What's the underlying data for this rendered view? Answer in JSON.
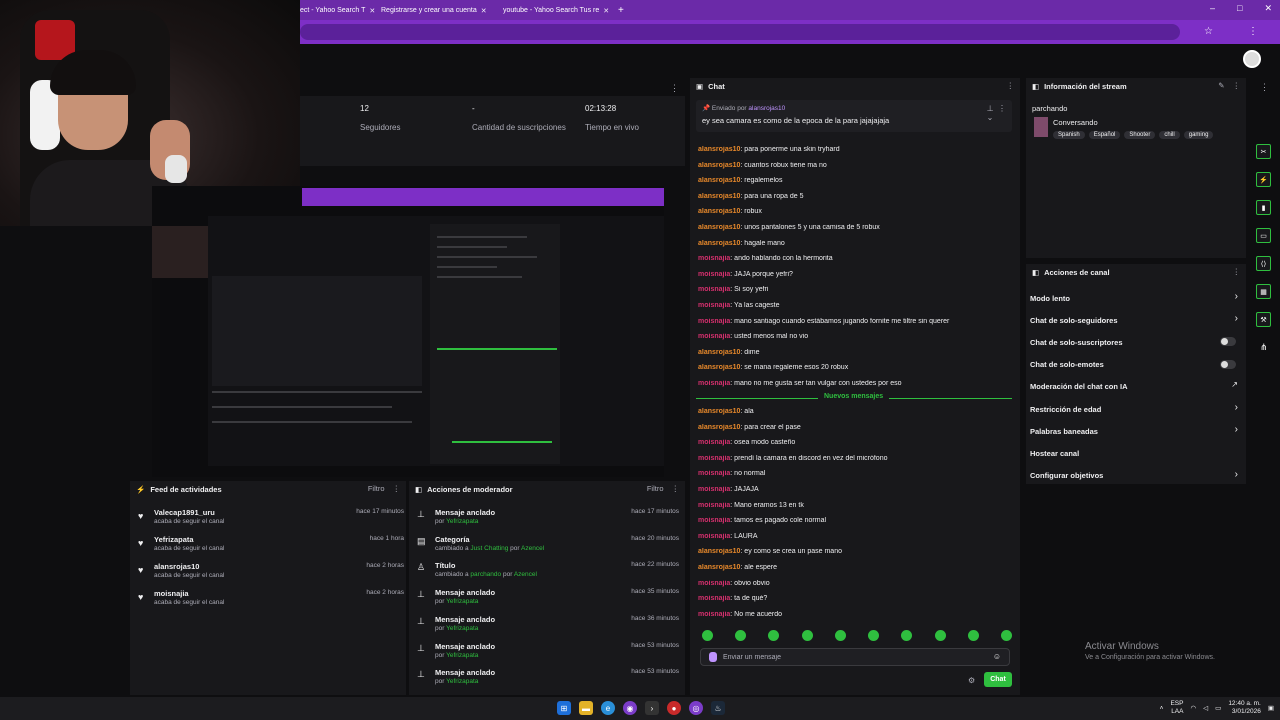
{
  "browser": {
    "tabs": [
      {
        "label": "ect - Yahoo Search T"
      },
      {
        "label": "Registrarse y crear una cuenta"
      },
      {
        "label": "youtube - Yahoo Search Tus re"
      }
    ],
    "new_tab": "+"
  },
  "stats": [
    {
      "value": "12",
      "label": "Seguidores"
    },
    {
      "value": "-",
      "label": "Cantidad de suscripciones"
    },
    {
      "value": "02:13:28",
      "label": "Tiempo en vivo"
    }
  ],
  "activity_feed": {
    "title": "Feed de actividades",
    "filter": "Filtro",
    "items": [
      {
        "user": "Valecap1891_uru",
        "action": "acaba de seguir el canal",
        "time": "hace 17 minutos"
      },
      {
        "user": "Yefrizapata",
        "action": "acaba de seguir el canal",
        "time": "hace 1 hora"
      },
      {
        "user": "alansrojas10",
        "action": "acaba de seguir el canal",
        "time": "hace 2 horas"
      },
      {
        "user": "moisnajia",
        "action": "acaba de seguir el canal",
        "time": "hace 2 horas"
      }
    ]
  },
  "mod_actions": {
    "title": "Acciones de moderador",
    "filter": "Filtro",
    "items": [
      {
        "icon": "pin-icon",
        "title": "Mensaje anclado",
        "pre": "por",
        "hl1": "Yefrizapata",
        "mid": "",
        "hl2": "",
        "time": "hace 17 minutos"
      },
      {
        "icon": "category-icon",
        "title": "Categoría",
        "pre": "cambiado a",
        "hl1": "Just Chatting",
        "mid": "por",
        "hl2": "Azencel",
        "time": "hace 20 minutos"
      },
      {
        "icon": "title-icon",
        "title": "Título",
        "pre": "cambiado a",
        "hl1": "parchando",
        "mid": "por",
        "hl2": "Azencel",
        "time": "hace 22 minutos"
      },
      {
        "icon": "pin-icon",
        "title": "Mensaje anclado",
        "pre": "por",
        "hl1": "Yefrizapata",
        "mid": "",
        "hl2": "",
        "time": "hace 35 minutos"
      },
      {
        "icon": "pin-icon",
        "title": "Mensaje anclado",
        "pre": "por",
        "hl1": "Yefrizapata",
        "mid": "",
        "hl2": "",
        "time": "hace 36 minutos"
      },
      {
        "icon": "pin-icon",
        "title": "Mensaje anclado",
        "pre": "por",
        "hl1": "Yefrizapata",
        "mid": "",
        "hl2": "",
        "time": "hace 53 minutos"
      },
      {
        "icon": "pin-icon",
        "title": "Mensaje anclado",
        "pre": "por",
        "hl1": "Yefrizapata",
        "mid": "",
        "hl2": "",
        "time": "hace 53 minutos"
      }
    ]
  },
  "chat": {
    "title": "Chat",
    "pinned": {
      "label": "Enviado por",
      "user": "alansrojas10",
      "message": "ey sea camara es como de la epoca de la para jajajajaja"
    },
    "messages": [
      {
        "user": "alansrojas10",
        "color": "#e8892b",
        "text": ": para ponerme una skin tryhard"
      },
      {
        "user": "alansrojas10",
        "color": "#e8892b",
        "text": ": cuantos robux tiene ma no"
      },
      {
        "user": "alansrojas10",
        "color": "#e8892b",
        "text": ": regalemelos"
      },
      {
        "user": "alansrojas10",
        "color": "#e8892b",
        "text": ": para una ropa de 5"
      },
      {
        "user": "alansrojas10",
        "color": "#e8892b",
        "text": ": robux"
      },
      {
        "user": "alansrojas10",
        "color": "#e8892b",
        "text": ": unos pantalones 5 y una camisa de 5 robux"
      },
      {
        "user": "alansrojas10",
        "color": "#e8892b",
        "text": ": hagale mano"
      },
      {
        "user": "moisnajia",
        "color": "#d6306e",
        "text": ": ando hablando con la hermorita"
      },
      {
        "user": "moisnajia",
        "color": "#d6306e",
        "text": ": JAJA porque yefri?"
      },
      {
        "user": "moisnajia",
        "color": "#d6306e",
        "text": ": Si soy yefri"
      },
      {
        "user": "moisnajia",
        "color": "#d6306e",
        "text": ": Ya las cageste"
      },
      {
        "user": "moisnajia",
        "color": "#d6306e",
        "text": ": mano santiago cuando estábamos jugando fornite me tiltre sin querer"
      },
      {
        "user": "moisnajia",
        "color": "#d6306e",
        "text": ": usted menos mal no vio"
      },
      {
        "user": "alansrojas10",
        "color": "#e8892b",
        "text": ": dime"
      },
      {
        "user": "alansrojas10",
        "color": "#e8892b",
        "text": ": se mana regaleme esos 20 robux"
      },
      {
        "user": "moisnajia",
        "color": "#d6306e",
        "text": ": mano no me gusta ser tan vulgar con ustedes por eso"
      }
    ],
    "new_messages_label": "Nuevos mensajes",
    "new_messages": [
      {
        "user": "alansrojas10",
        "color": "#e8892b",
        "text": ": ala"
      },
      {
        "user": "alansrojas10",
        "color": "#e8892b",
        "text": ": para crear el pase"
      },
      {
        "user": "moisnajia",
        "color": "#d6306e",
        "text": ": osea modo casteño"
      },
      {
        "user": "moisnajia",
        "color": "#d6306e",
        "text": ": prendí la camara en discord en vez del micrófono"
      },
      {
        "user": "moisnajia",
        "color": "#d6306e",
        "text": ": no normal"
      },
      {
        "user": "moisnajia",
        "color": "#d6306e",
        "text": ": JAJAJA"
      },
      {
        "user": "moisnajia",
        "color": "#d6306e",
        "text": ": Mano eramos 13 en tk"
      },
      {
        "user": "moisnajia",
        "color": "#d6306e",
        "text": ": tamos es pagado cole normal"
      },
      {
        "user": "moisnajia",
        "color": "#d6306e",
        "text": ": LAURA"
      },
      {
        "user": "alansrojas10",
        "color": "#e8892b",
        "text": ": ey como se crea un pase mano"
      },
      {
        "user": "alansrojas10",
        "color": "#e8892b",
        "text": ": ale espere"
      },
      {
        "user": "moisnajia",
        "color": "#d6306e",
        "text": ": obvio obvio"
      },
      {
        "user": "moisnajia",
        "color": "#d6306e",
        "text": ": ta de qué?"
      },
      {
        "user": "moisnajia",
        "color": "#d6306e",
        "text": ": No me acuerdo"
      }
    ],
    "input_placeholder": "Enviar un mensaje",
    "send_label": "Chat"
  },
  "stream_info": {
    "title": "Información del stream",
    "stream_title": "parchando",
    "category": "Conversando",
    "tags": [
      "Spanish",
      "Español",
      "Shooter",
      "chill",
      "gaming"
    ]
  },
  "channel_actions": {
    "title": "Acciones de canal",
    "items": [
      {
        "label": "Modo lento",
        "control": "arrow"
      },
      {
        "label": "Chat de solo-seguidores",
        "control": "arrow"
      },
      {
        "label": "Chat de solo-suscriptores",
        "control": "toggle"
      },
      {
        "label": "Chat de solo-emotes",
        "control": "toggle"
      },
      {
        "label": "Moderación del chat con IA",
        "control": "external"
      },
      {
        "label": "Restricción de edad",
        "control": "arrow"
      },
      {
        "label": "Palabras baneadas",
        "control": "arrow"
      },
      {
        "label": "Hostear canal",
        "control": "none"
      },
      {
        "label": "Configurar objetivos",
        "control": "arrow"
      }
    ]
  },
  "windows_watermark": {
    "line1": "Activar Windows",
    "line2": "Ve a Configuración para activar Windows."
  },
  "taskbar": {
    "lang": "ESP",
    "lang2": "LAA",
    "time": "12:40 a. m.",
    "date": "3/01/2026"
  },
  "colors": {
    "accent_purple": "#7d2fc6",
    "accent_green": "#2fbf3f",
    "panel_bg": "#18181b"
  }
}
